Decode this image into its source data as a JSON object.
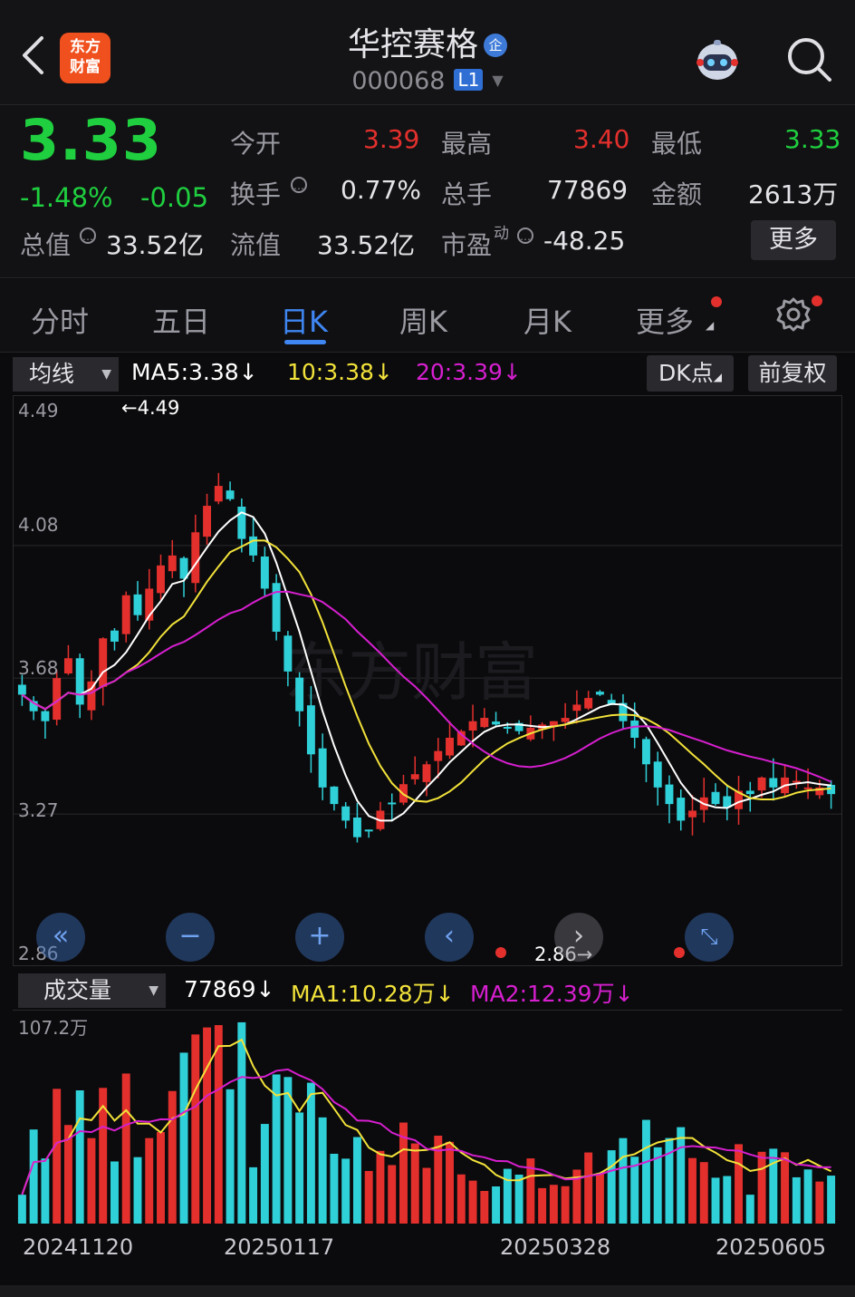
{
  "header": {
    "app_logo_text": "东方财富",
    "stock_name": "华控赛格",
    "enterprise_badge": "企",
    "stock_code": "000068",
    "level_badge": "L1"
  },
  "quote": {
    "price": "3.33",
    "change_pct": "-1.48%",
    "change": "-0.05",
    "total_mv_label": "总值",
    "total_mv": "33.52亿",
    "open_label": "今开",
    "open": "3.39",
    "high_label": "最高",
    "high": "3.40",
    "low_label": "最低",
    "low": "3.33",
    "turnover_label": "换手",
    "turnover": "0.77%",
    "volume_label": "总手",
    "volume": "77869",
    "amount_label": "金额",
    "amount": "2613万",
    "float_mv_label": "流值",
    "float_mv": "33.52亿",
    "pe_label": "市盈",
    "pe_sup": "动",
    "pe": "-48.25",
    "more_button": "更多"
  },
  "tabs": [
    {
      "label": "分时"
    },
    {
      "label": "五日"
    },
    {
      "label": "日K"
    },
    {
      "label": "周K"
    },
    {
      "label": "月K"
    },
    {
      "label": "更多"
    }
  ],
  "active_tab": "日K",
  "ma_bar": {
    "selector": "均线",
    "ma5": "MA5:3.38↓",
    "ma10": "10:3.38↓",
    "ma20": "20:3.39↓",
    "dk_button": "DK点",
    "adjust_button": "前复权"
  },
  "price_axis": [
    "4.49",
    "4.08",
    "3.68",
    "3.27",
    "2.86"
  ],
  "annotations": {
    "max": "←4.49",
    "min": "2.86→"
  },
  "volume_bar": {
    "selector": "成交量",
    "vol": "77869↓",
    "ma1": "MA1:10.28万↓",
    "ma2": "MA2:12.39万↓",
    "axis_max": "107.2万"
  },
  "dates": [
    "20241120",
    "20250117",
    "20250328",
    "20250605"
  ],
  "colors": {
    "up": "#e3302d",
    "down": "#2fd0d8",
    "ma5": "#ffffff",
    "ma10": "#f2e23a",
    "ma20": "#d61fcf",
    "accent": "#3f86f2",
    "price": "#1fcf3f"
  },
  "chart_data": {
    "type": "candlestick",
    "ylim": [
      2.86,
      4.49
    ],
    "close": [
      3.63,
      3.58,
      3.55,
      3.68,
      3.74,
      3.6,
      3.67,
      3.8,
      3.79,
      3.93,
      3.87,
      3.95,
      4.02,
      4.05,
      3.98,
      4.12,
      4.2,
      4.26,
      4.22,
      4.1,
      4.05,
      3.95,
      3.82,
      3.7,
      3.58,
      3.45,
      3.35,
      3.3,
      3.25,
      3.2,
      3.22,
      3.28,
      3.3,
      3.36,
      3.39,
      3.42,
      3.46,
      3.5,
      3.52,
      3.55,
      3.56,
      3.54,
      3.53,
      3.52,
      3.53,
      3.54,
      3.55,
      3.56,
      3.6,
      3.62,
      3.63,
      3.6,
      3.55,
      3.5,
      3.42,
      3.35,
      3.3,
      3.25,
      3.28,
      3.32,
      3.3,
      3.29,
      3.34,
      3.33,
      3.38,
      3.35,
      3.38,
      3.37,
      3.35,
      3.35,
      3.33
    ],
    "volume_max": 107.2
  }
}
